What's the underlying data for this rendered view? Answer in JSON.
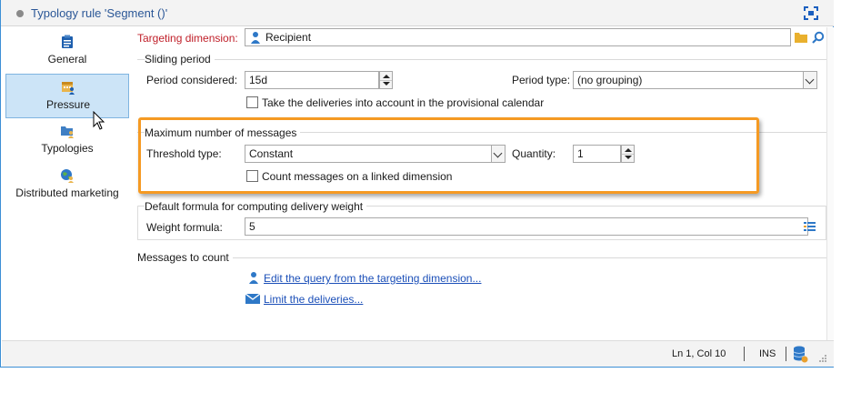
{
  "window": {
    "title": "Typology rule 'Segment ()'",
    "accent_color": "#3c8fd6",
    "maximize_icon": "maximize-icon"
  },
  "sidebar": {
    "items": [
      {
        "label": "General",
        "icon": "clipboard-icon",
        "selected": false
      },
      {
        "label": "Pressure",
        "icon": "calendar-user-icon",
        "selected": true
      },
      {
        "label": "Typologies",
        "icon": "folder-user-icon",
        "selected": false
      },
      {
        "label": "Distributed marketing",
        "icon": "globe-user-icon",
        "selected": false
      }
    ]
  },
  "targeting": {
    "label": "Targeting dimension:",
    "value": "Recipient",
    "label_color": "#c0202a"
  },
  "sliding_period": {
    "title": "Sliding period",
    "period_label": "Period considered:",
    "period_value": "15d",
    "period_type_label": "Period type:",
    "period_type_value": "(no grouping)",
    "provisional_checkbox_label": "Take the deliveries into account in the provisional calendar",
    "provisional_checked": false
  },
  "max_messages": {
    "title": "Maximum number of messages",
    "threshold_label": "Threshold type:",
    "threshold_value": "Constant",
    "quantity_label": "Quantity:",
    "quantity_value": "1",
    "linked_checkbox_label": "Count messages on a linked dimension",
    "linked_checked": false,
    "highlight_color": "#f59a23"
  },
  "weight": {
    "title": "Default formula for computing delivery weight",
    "formula_label": "Weight formula:",
    "formula_value": "5"
  },
  "messages_to_count": {
    "title": "Messages to count",
    "edit_query_link": "Edit the query from the targeting dimension...",
    "limit_link": "Limit the deliveries..."
  },
  "statusbar": {
    "position": "Ln 1, Col 10",
    "mode": "INS"
  }
}
